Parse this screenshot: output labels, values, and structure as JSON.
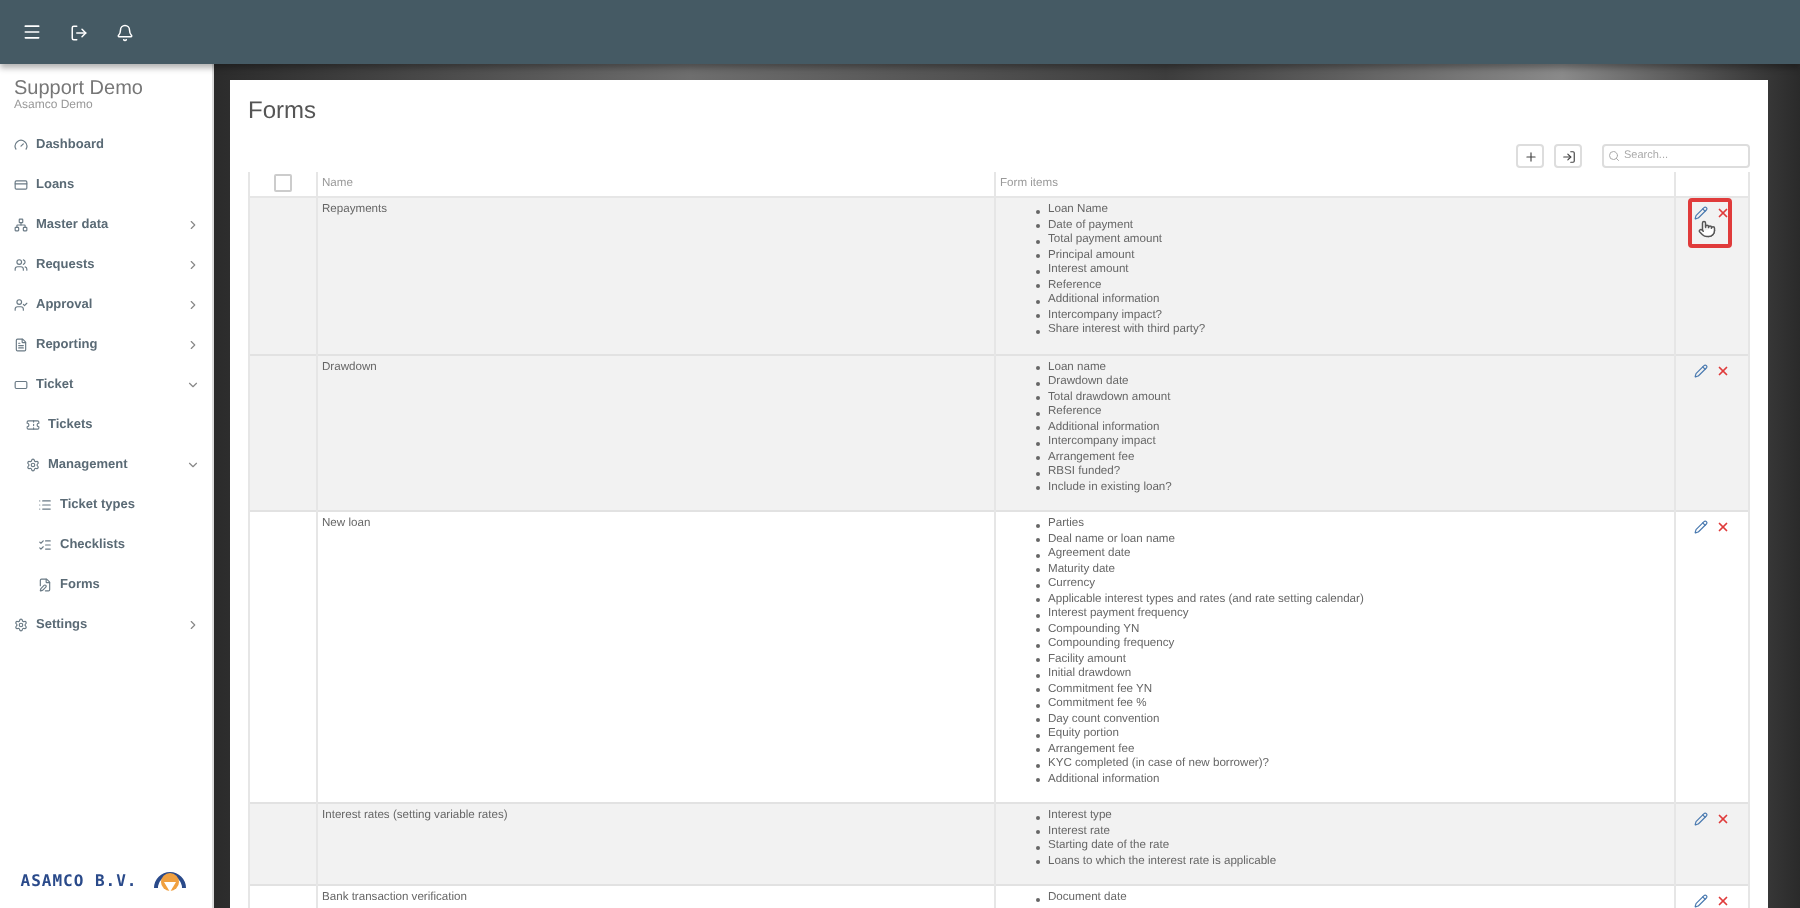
{
  "sidebar": {
    "title": "Support Demo",
    "subtitle": "Asamco Demo",
    "items": [
      {
        "label": "Dashboard",
        "has_children": false
      },
      {
        "label": "Loans",
        "has_children": false
      },
      {
        "label": "Master data",
        "has_children": true,
        "expanded": false
      },
      {
        "label": "Requests",
        "has_children": true,
        "expanded": false
      },
      {
        "label": "Approval",
        "has_children": true,
        "expanded": false
      },
      {
        "label": "Reporting",
        "has_children": true,
        "expanded": false
      },
      {
        "label": "Ticket",
        "has_children": true,
        "expanded": true,
        "children": [
          {
            "label": "Tickets",
            "has_children": false
          },
          {
            "label": "Management",
            "has_children": true,
            "expanded": true,
            "children": [
              {
                "label": "Ticket types",
                "has_children": false
              },
              {
                "label": "Checklists",
                "has_children": false
              },
              {
                "label": "Forms",
                "has_children": false
              }
            ]
          }
        ]
      },
      {
        "label": "Settings",
        "has_children": true,
        "expanded": false
      }
    ],
    "logo_text": "ASAMCO B.V."
  },
  "page": {
    "title": "Forms",
    "search": {
      "placeholder": "Search..."
    },
    "table": {
      "select_all_checked": false,
      "columns": [
        "Name",
        "Form items"
      ],
      "rows": [
        {
          "name": "Repayments",
          "hovered": true,
          "items": [
            "Loan Name",
            "Date of payment",
            "Total payment amount",
            "Principal amount",
            "Interest amount",
            "Reference",
            "Additional information",
            "Intercompany impact?",
            "Share interest with third party?"
          ]
        },
        {
          "name": "Drawdown",
          "hovered": false,
          "items": [
            "Loan name",
            "Drawdown date",
            "Total drawdown amount",
            "Reference",
            "Additional information",
            "Intercompany impact",
            "Arrangement fee",
            "RBSI funded?",
            "Include in existing loan?"
          ]
        },
        {
          "name": "New loan",
          "hovered": false,
          "items": [
            "Parties",
            "Deal name or loan name",
            "Agreement date",
            "Maturity date",
            "Currency",
            "Applicable interest types and rates (and rate setting calendar)",
            "Interest payment frequency",
            "Compounding YN",
            "Compounding frequency",
            "Facility amount",
            "Initial drawdown",
            "Commitment fee YN",
            "Commitment fee %",
            "Day count convention",
            "Equity portion",
            "Arrangement fee",
            "KYC completed (in case of new borrower)?",
            "Additional information"
          ]
        },
        {
          "name": "Interest rates (setting variable rates)",
          "hovered": false,
          "items": [
            "Interest type",
            "Interest rate",
            "Starting date of the rate",
            "Loans to which the interest rate is applicable"
          ]
        },
        {
          "name": "Bank transaction verification",
          "hovered": false,
          "items": [
            "Document date"
          ]
        }
      ]
    }
  }
}
